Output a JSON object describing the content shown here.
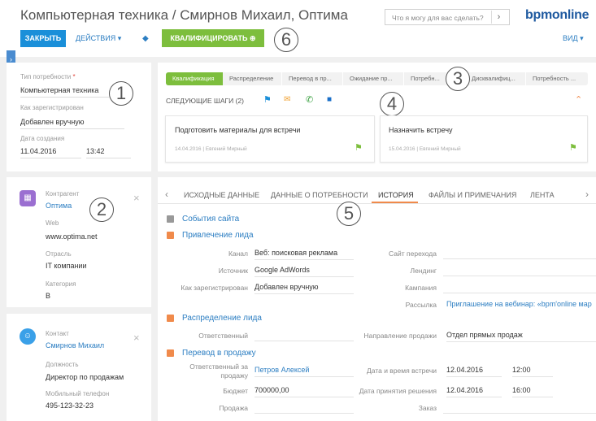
{
  "header": {
    "title": "Компьютерная техника / Смирнов Михаил, Оптима",
    "search_placeholder": "Что я могу для вас сделать?",
    "brand": "bpmonline",
    "close_label": "ЗАКРЫТЬ",
    "actions_label": "ДЕЙСТВИЯ ▾",
    "qualify_label": "КВАЛИФИЦИРОВАТЬ ⊕",
    "view_label": "ВИД ▾"
  },
  "callouts": [
    "1",
    "2",
    "3",
    "4",
    "5",
    "6"
  ],
  "profile": {
    "need_type_label": "Тип потребности",
    "required_mark": "*",
    "need_type_value": "Компьютерная техника",
    "registered_label": "Как зарегистрирован",
    "registered_value": "Добавлен вручную",
    "created_label": "Дата создания",
    "created_date": "11.04.2016",
    "created_time": "13:42"
  },
  "account": {
    "label": "Контрагент",
    "name": "Оптима",
    "web_label": "Web",
    "web_value": "www.optima.net",
    "industry_label": "Отрасль",
    "industry_value": "IT компании",
    "category_label": "Категория",
    "category_value": "B"
  },
  "contact": {
    "label": "Контакт",
    "name": "Смирнов Михаил",
    "position_label": "Должность",
    "position_value": "Директор по продажам",
    "mobile_label": "Мобильный телефон",
    "mobile_value": "495-123-32-23"
  },
  "stages": [
    "Квалификация",
    "Распределение",
    "Перевод в пр...",
    "Ожидание пр...",
    "Потребн...",
    "Дисквалифиц...",
    "Потребность ..."
  ],
  "next_steps": {
    "title": "СЛЕДУЮЩИЕ ШАГИ (2)",
    "cards": [
      {
        "title": "Подготовить материалы для встречи",
        "meta": "14.04.2016 | Евгений Мирный"
      },
      {
        "title": "Назначить встречу",
        "meta": "15.04.2016 | Евгений Мирный"
      }
    ]
  },
  "tabs": [
    "ИСХОДНЫЕ ДАННЫЕ",
    "ДАННЫЕ О ПОТРЕБНОСТИ",
    "ИСТОРИЯ",
    "ФАЙЛЫ И ПРИМЕЧАНИЯ",
    "ЛЕНТА"
  ],
  "active_tab": "ИСТОРИЯ",
  "history": {
    "site_events": "События сайта",
    "lead_attraction": "Привлечение лида",
    "channel_label": "Канал",
    "channel_value": "Веб: поисковая реклама",
    "source_label": "Источник",
    "source_value": "Google AdWords",
    "registered_label": "Как зарегистрирован",
    "registered_value": "Добавлен вручную",
    "referrer_label": "Сайт перехода",
    "landing_label": "Лендинг",
    "campaign_label": "Кампания",
    "mailing_label": "Рассылка",
    "mailing_value": "Приглашение на вебинар: «bpm'online мар",
    "lead_distribution": "Распределение лида",
    "responsible_label": "Ответственный",
    "direction_label": "Направление продажи",
    "direction_value": "Отдел прямых продаж",
    "transfer": "Перевод в продажу",
    "sales_resp_label": "Ответственный за продажу",
    "sales_resp_value": "Петров Алексей",
    "meeting_label": "Дата и время встречи",
    "meeting_date": "12.04.2016",
    "meeting_time": "12:00",
    "budget_label": "Бюджет",
    "budget_value": "700000,00",
    "decision_label": "Дата принятия решения",
    "decision_date": "12.04.2016",
    "decision_time": "16:00",
    "sale_label": "Продажа",
    "order_label": "Заказ"
  },
  "colors": {
    "accent": "#1a8fd9",
    "qualify": "#7dbe3d",
    "stage_active": "#7dbe3d",
    "section": "#f08a4b"
  }
}
